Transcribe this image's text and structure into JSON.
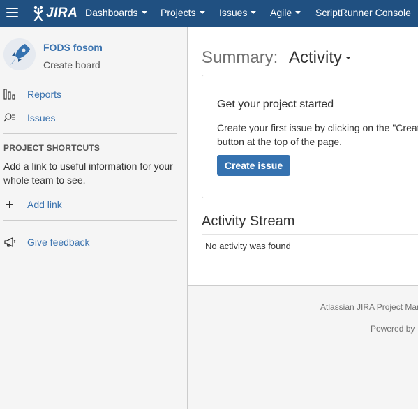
{
  "nav": {
    "logo_text": "JIRA",
    "items": [
      {
        "label": "Dashboards",
        "dropdown": true
      },
      {
        "label": "Projects",
        "dropdown": true
      },
      {
        "label": "Issues",
        "dropdown": true
      },
      {
        "label": "Agile",
        "dropdown": true
      },
      {
        "label": "ScriptRunner Console",
        "dropdown": false
      }
    ],
    "bg_color": "#205081"
  },
  "sidebar": {
    "project_name": "FODS fosom",
    "project_subtitle": "Create board",
    "links": [
      {
        "label": "Reports",
        "icon": "bar-chart-icon"
      },
      {
        "label": "Issues",
        "icon": "issues-search-icon"
      }
    ],
    "shortcuts": {
      "title": "PROJECT SHORTCUTS",
      "description": "Add a link to useful information for your whole team to see.",
      "add_link_label": "Add link"
    },
    "feedback_label": "Give feedback"
  },
  "main": {
    "summary_label": "Summary:",
    "view_selector": "Activity",
    "card": {
      "title": "Get your project started",
      "text": "Create your first issue by clicking on the \"Creat button at the top of the page.",
      "button_label": "Create issue"
    },
    "stream": {
      "title": "Activity Stream",
      "empty_text": "No activity was found"
    }
  },
  "footer": {
    "line1": "Atlassian JIRA Project Mar",
    "line2": "Powered by"
  },
  "colors": {
    "link": "#3b73af",
    "primary_button": "#3572b0"
  }
}
